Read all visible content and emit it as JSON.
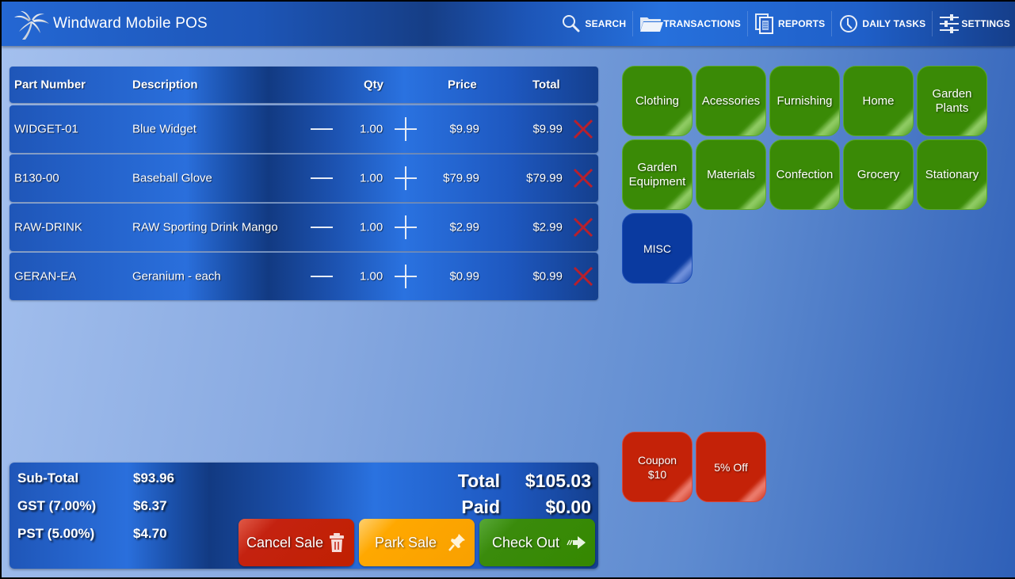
{
  "header": {
    "title": "Windward Mobile POS",
    "logo_icon": "palm-tree-icon",
    "nav": [
      {
        "label": "SEARCH",
        "icon": "search-icon"
      },
      {
        "label": "TRANSACTIONS",
        "icon": "folder-icon"
      },
      {
        "label": "REPORTS",
        "icon": "reports-icon"
      },
      {
        "label": "DAILY TASKS",
        "icon": "clock-icon"
      },
      {
        "label": "SETTINGS",
        "icon": "sliders-icon"
      }
    ]
  },
  "table": {
    "columns": [
      "Part Number",
      "Description",
      "Qty",
      "Price",
      "Total"
    ],
    "rows": [
      {
        "part": "WIDGET-01",
        "description": "Blue Widget",
        "qty": "1.00",
        "price": "$9.99",
        "total": "$9.99"
      },
      {
        "part": "B130-00",
        "description": "Baseball Glove",
        "qty": "1.00",
        "price": "$79.99",
        "total": "$79.99"
      },
      {
        "part": "RAW-DRINK",
        "description": "RAW Sporting Drink Mango",
        "qty": "1.00",
        "price": "$2.99",
        "total": "$2.99"
      },
      {
        "part": "GERAN-EA",
        "description": "Geranium - each",
        "qty": "1.00",
        "price": "$0.99",
        "total": "$0.99"
      }
    ]
  },
  "summary": {
    "subtotal_label": "Sub-Total",
    "subtotal": "$93.96",
    "gst_label": "GST (7.00%)",
    "gst": "$6.37",
    "pst_label": "PST (5.00%)",
    "pst": "$4.70",
    "total_label": "Total",
    "total": "$105.03",
    "paid_label": "Paid",
    "paid": "$0.00"
  },
  "actions": {
    "cancel": "Cancel Sale",
    "park": "Park Sale",
    "checkout": "Check Out"
  },
  "categories": [
    {
      "label": "Clothing",
      "color": "#3a8a06"
    },
    {
      "label": "Acessories",
      "color": "#3a8a06"
    },
    {
      "label": "Furnishing",
      "color": "#3a8a06"
    },
    {
      "label": "Home",
      "color": "#3a8a06"
    },
    {
      "label": "Garden Plants",
      "color": "#3a8a06"
    },
    {
      "label": "Garden Equipment",
      "color": "#3a8a06"
    },
    {
      "label": "Materials",
      "color": "#3a8a06"
    },
    {
      "label": "Confection",
      "color": "#3a8a06"
    },
    {
      "label": "Grocery",
      "color": "#3a8a06"
    },
    {
      "label": "Stationary",
      "color": "#3a8a06"
    },
    {
      "label": "MISC",
      "color": "#0a3aa0"
    }
  ],
  "discounts": [
    {
      "label": "Coupon $10",
      "color": "#c42208"
    },
    {
      "label": "5% Off",
      "color": "#c42208"
    }
  ]
}
